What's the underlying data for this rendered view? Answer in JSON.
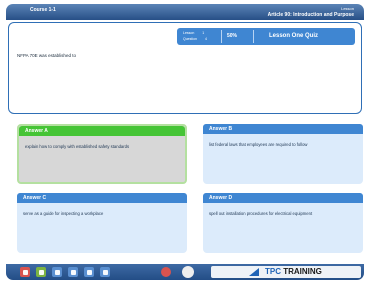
{
  "window": {
    "left_title": "Course 1-1",
    "right_top": "Lesson",
    "right_bottom": "Article 90: Introduction and Purpose"
  },
  "question": {
    "text": "NFPA 70E was established to"
  },
  "lesson_bar": {
    "lesson_label": "Lesson",
    "lesson_value": "1",
    "question_label": "Question",
    "question_value": "4",
    "percent": "50%",
    "quiz_title": "Lesson One Quiz"
  },
  "answers": [
    {
      "label": "Answer A",
      "text": "explain how to comply with established safety standards"
    },
    {
      "label": "Answer B",
      "text": "list federal laws that employees are required to follow"
    },
    {
      "label": "Answer C",
      "text": "serve as a guide for inspecting a workplace"
    },
    {
      "label": "Answer D",
      "text": "spell out installation procedures for electrical equipment"
    }
  ],
  "footer": {
    "brand_prefix": "TPC",
    "brand_suffix": "TRAINING"
  },
  "icons": {
    "stop": "stop-icon",
    "speaker": "speaker-icon"
  }
}
